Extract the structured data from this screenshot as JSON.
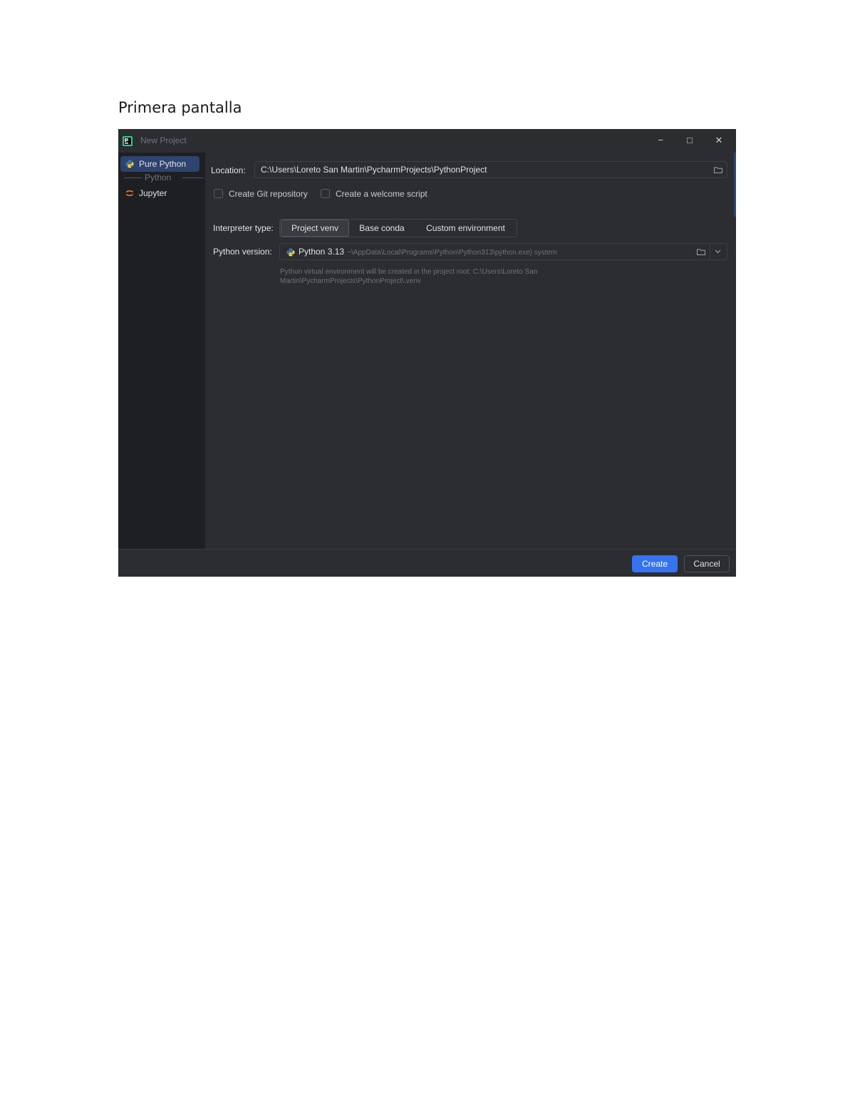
{
  "caption": "Primera pantalla",
  "window": {
    "title": "New Project",
    "controls": {
      "minimize": "−",
      "maximize": "□",
      "close": "✕"
    }
  },
  "sidebar": {
    "items": [
      {
        "label": "Pure Python",
        "icon": "python-icon"
      },
      {
        "label": "Jupyter",
        "icon": "jupyter-icon"
      }
    ],
    "group_label": "Python"
  },
  "form": {
    "location_label": "Location:",
    "location_value": "C:\\Users\\Loreto San Martin\\PycharmProjects\\PythonProject",
    "create_git_label": "Create Git repository",
    "create_welcome_label": "Create a welcome script",
    "interpreter_label": "Interpreter type:",
    "interpreter_options": [
      "Project venv",
      "Base conda",
      "Custom environment"
    ],
    "python_version_label": "Python version:",
    "python_version_value": "Python 3.13",
    "python_version_path": "~\\AppData\\Local\\Programs\\Python\\Python313\\python.exe) system",
    "hint": "Python virtual environment will be created in the project root: C:\\Users\\Loreto San Martin\\PycharmProjects\\PythonProject\\.venv"
  },
  "footer": {
    "create_label": "Create",
    "cancel_label": "Cancel"
  },
  "colors": {
    "accent": "#3574f0",
    "window_bg": "#2b2d30",
    "sidebar_bg": "#1e1f22",
    "selection": "#2e436e"
  }
}
